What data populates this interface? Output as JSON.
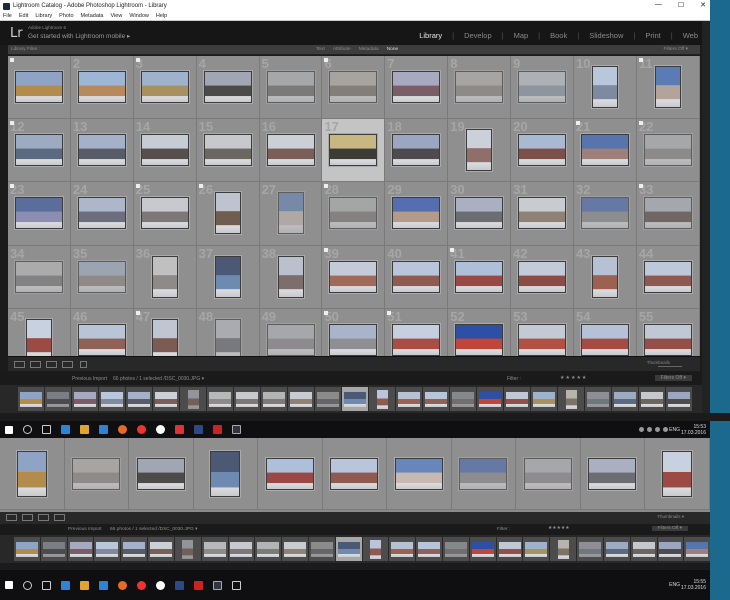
{
  "window": {
    "title": "Lightroom Catalog - Adobe Photoshop Lightroom - Library",
    "controls": [
      "—",
      "☐",
      "✕"
    ]
  },
  "menu": [
    "File",
    "Edit",
    "Library",
    "Photo",
    "Metadata",
    "View",
    "Window",
    "Help"
  ],
  "identity": {
    "logo": "Lr",
    "subtitle": "Adobe Lightroom 6",
    "mobile": "Get started with Lightroom mobile  ▸"
  },
  "modules": [
    "Library",
    "Develop",
    "Map",
    "Book",
    "Slideshow",
    "Print",
    "Web"
  ],
  "active_module": "Library",
  "filter_bar": {
    "label": "Library Filter :",
    "tabs": [
      "Text",
      "Attribute",
      "Metadata",
      "None"
    ],
    "active_tab": "None",
    "filters_off": "Filters Off  ▾"
  },
  "grid": {
    "numbers": [
      "",
      "2",
      "3",
      "4",
      "5",
      "6",
      "7",
      "8",
      "9",
      "10",
      "11",
      "12",
      "13",
      "14",
      "15",
      "16",
      "17",
      "18",
      "19",
      "20",
      "21",
      "22",
      "23",
      "24",
      "25",
      "26",
      "27",
      "28",
      "29",
      "30",
      "31",
      "32",
      "33",
      "34",
      "35",
      "36",
      "37",
      "38",
      "39",
      "40",
      "41",
      "42",
      "43",
      "44",
      "45",
      "46",
      "47",
      "48",
      "49",
      "50",
      "51",
      "52",
      "53",
      "54",
      "55"
    ],
    "selected": 16
  },
  "toolbar": {
    "thumbnails": "Thumbnails"
  },
  "filmstrip": {
    "source": "Previous Import",
    "count": "66 photos / 1 selected /DSC_0030.JPG  ▾",
    "filter": "Filter :",
    "stars": "★★★★★",
    "filters_off": "Filters Off  ▾"
  },
  "lower": {
    "count": "66 photos / 1 selected /DSC_0030.JPG  ▾",
    "thumbnails": "Thumbnails  ▾",
    "filters_off": "Filters Off  ▾"
  },
  "taskbar": {
    "lang": "ENG",
    "time": "15:53",
    "date": "17.03.2016",
    "time2": "15:55",
    "date2": "17.03.2016"
  }
}
